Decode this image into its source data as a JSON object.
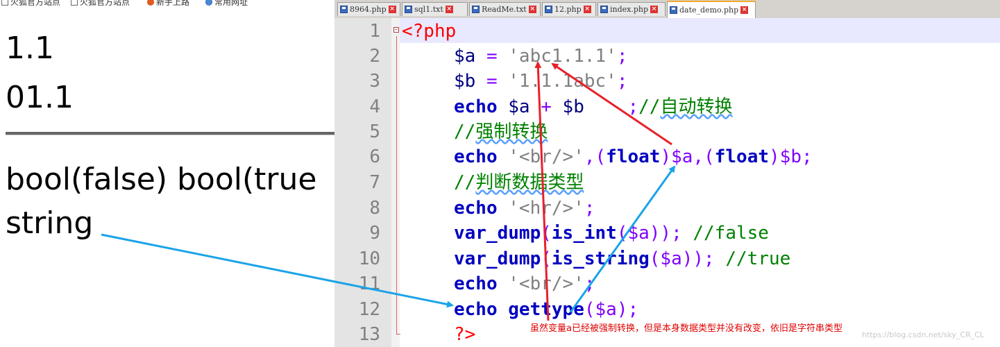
{
  "browser": {
    "bookmarks": [
      "火狐官方站点",
      "火狐官方站点",
      "新手上路",
      "常用网址"
    ],
    "output_lines": [
      "1.1",
      "01.1"
    ],
    "dump_output": "bool(false) bool(true",
    "type_output": "string"
  },
  "editor": {
    "tabs": [
      {
        "label": "8964.php",
        "active": false
      },
      {
        "label": "sql1.txt",
        "active": false
      },
      {
        "label": "ReadMe.txt",
        "active": false
      },
      {
        "label": "12.php",
        "active": false
      },
      {
        "label": "index.php",
        "active": false
      },
      {
        "label": "date_demo.php",
        "active": true
      }
    ],
    "line_numbers": [
      "1",
      "2",
      "3",
      "4",
      "5",
      "6",
      "7",
      "8",
      "9",
      "10",
      "11",
      "12",
      "13"
    ],
    "code": {
      "l1": {
        "tag": "<?php"
      },
      "l2": {
        "var": "$a",
        "op": " = ",
        "str": "'abc1.1.1'",
        "end": ";"
      },
      "l3": {
        "var": "$b",
        "op": " = ",
        "str": "'1.1.1abc'",
        "end": ";"
      },
      "l4": {
        "kw": "echo",
        "a": " $a ",
        "op": "+",
        "b": " $b ",
        "sp": "   ",
        "semi": ";",
        "cmt": "//",
        "cn": "自动转换"
      },
      "l5": {
        "cmt": "//",
        "cn": "强制转换"
      },
      "l6": {
        "kw": "echo",
        "str": " '<br/>'",
        "c1": ",(",
        "kw2": "float",
        "v1": ")$a,(",
        "kw3": "float",
        "v2": ")$b;"
      },
      "l7": {
        "cmt": "//",
        "cn": "判断数据类型"
      },
      "l8": {
        "kw": "echo",
        "str": " '<hr/>'",
        "end": ";"
      },
      "l9": {
        "kw": "var_dump",
        "p1": "(",
        "kw2": "is_int",
        "p2": "($a)); ",
        "cmt": "//false"
      },
      "l10": {
        "kw": "var_dump",
        "p1": "(",
        "kw2": "is_string",
        "p2": "($a)); ",
        "cmt": "//true"
      },
      "l11": {
        "kw": "echo",
        "str": " '<br/>'",
        "end": ";"
      },
      "l12": {
        "kw": "echo",
        "kw2": " gettype",
        "p": "($a);"
      },
      "l13": {
        "tag": "?>"
      }
    },
    "annotation": "虽然变量a已经被强制转换，但是本身数据类型并没有改变，依旧是字符串类型",
    "watermark": "https://blog.csdn.net/sky_CR_CL"
  },
  "colors": {
    "arrow_red": "#e8202a",
    "arrow_blue": "#1aa3e8"
  }
}
